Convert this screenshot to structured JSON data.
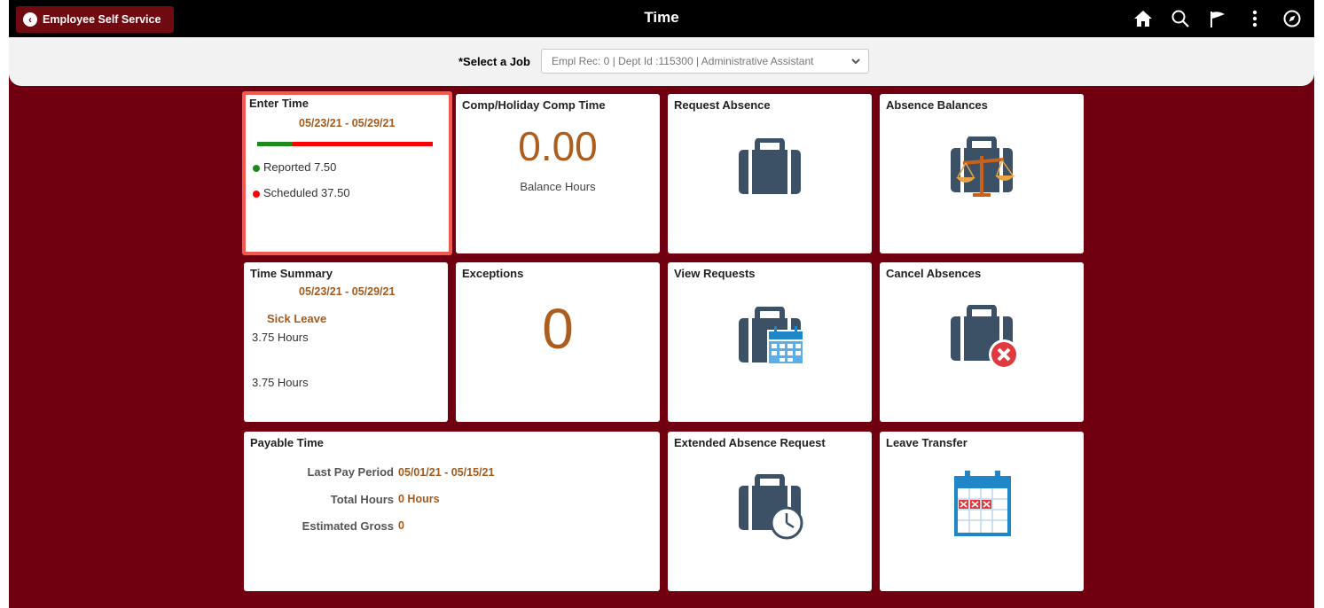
{
  "header": {
    "back_label": "Employee Self Service",
    "title": "Time"
  },
  "job": {
    "label": "*Select a Job",
    "value": "Empl Rec: 0 | Dept Id :115300 | Administrative Assistant"
  },
  "tiles": {
    "enter_time": {
      "title": "Enter Time",
      "period": "05/23/21 - 05/29/21",
      "reported": "Reported 7.50",
      "scheduled": "Scheduled 37.50",
      "reported_hours": 7.5,
      "scheduled_hours": 37.5
    },
    "comp": {
      "title": "Comp/Holiday Comp Time",
      "value": "0.00",
      "caption": "Balance Hours"
    },
    "request_absence": {
      "title": "Request Absence"
    },
    "absence_balances": {
      "title": "Absence Balances"
    },
    "time_summary": {
      "title": "Time Summary",
      "period": "05/23/21 - 05/29/21",
      "category": "Sick Leave",
      "category_hours": "3.75 Hours",
      "total_hours": "3.75 Hours"
    },
    "exceptions": {
      "title": "Exceptions",
      "value": "0"
    },
    "view_requests": {
      "title": "View Requests"
    },
    "cancel_absences": {
      "title": "Cancel Absences"
    },
    "payable_time": {
      "title": "Payable Time",
      "last_pay_label": "Last Pay Period",
      "last_pay_value": "05/01/21 - 05/15/21",
      "total_label": "Total Hours",
      "total_value": "0 Hours",
      "gross_label": "Estimated Gross",
      "gross_value": "0"
    },
    "extended_absence": {
      "title": "Extended Absence Request"
    },
    "leave_transfer": {
      "title": "Leave Transfer"
    }
  },
  "colors": {
    "background": "#70000f",
    "accent_orange": "#a15b21",
    "selected_border": "#f05a4f",
    "icon_slate": "#3d5166",
    "reported_green": "#1e8a1e",
    "scheduled_red": "#ff0000"
  },
  "icons": [
    "home-icon",
    "search-icon",
    "flag-icon",
    "more-icon",
    "compass-icon"
  ]
}
